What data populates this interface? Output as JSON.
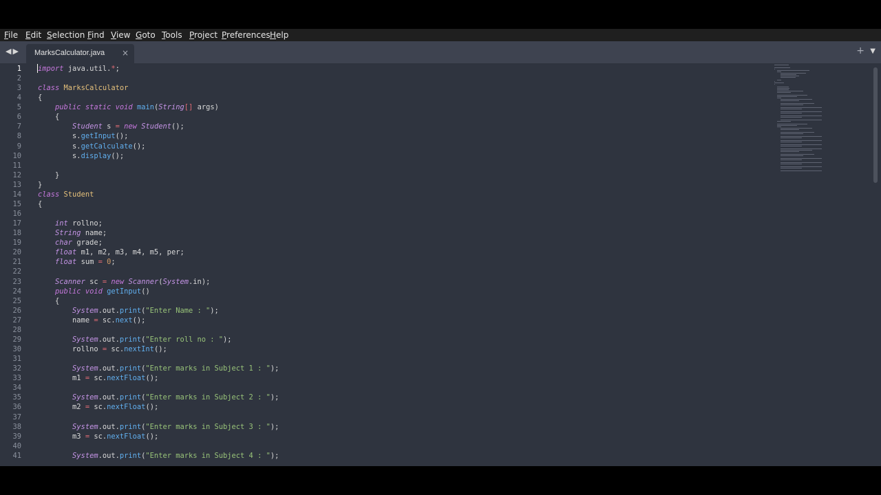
{
  "menu": [
    {
      "label": "File"
    },
    {
      "label": "Edit"
    },
    {
      "label": "Selection"
    },
    {
      "label": "Find"
    },
    {
      "label": "View"
    },
    {
      "label": "Goto"
    },
    {
      "label": "Tools"
    },
    {
      "label": "Project"
    },
    {
      "label": "Preferences"
    },
    {
      "label": "Help"
    }
  ],
  "tabs": {
    "nav_back": "◀",
    "nav_forward": "▶",
    "active_label": "MarksCalculator.java",
    "close_icon": "×",
    "new_tab_icon": "+",
    "menu_icon": "▼"
  },
  "editor": {
    "line_numbers": [
      "1",
      "2",
      "3",
      "4",
      "5",
      "6",
      "7",
      "8",
      "9",
      "10",
      "11",
      "12",
      "13",
      "14",
      "15",
      "16",
      "17",
      "18",
      "19",
      "20",
      "21",
      "22",
      "23",
      "24",
      "25",
      "26",
      "27",
      "28",
      "29",
      "30",
      "31",
      "32",
      "33",
      "34",
      "35",
      "36",
      "37",
      "38",
      "39",
      "40",
      "41"
    ],
    "lines": [
      "import java.util.*;",
      "",
      "class MarksCalculator",
      "{",
      "    public static void main(String[] args)",
      "    {",
      "        Student s = new Student();",
      "        s.getInput();",
      "        s.getCalculate();",
      "        s.display();",
      "",
      "    }",
      "}",
      "class Student",
      "{",
      "",
      "    int rollno;",
      "    String name;",
      "    char grade;",
      "    float m1, m2, m3, m4, m5, per;",
      "    float sum = 0;",
      "",
      "    Scanner sc = new Scanner(System.in);",
      "    public void getInput()",
      "    {",
      "        System.out.print(\"Enter Name : \");",
      "        name = sc.next();",
      "",
      "        System.out.print(\"Enter roll no : \");",
      "        rollno = sc.nextInt();",
      "",
      "        System.out.print(\"Enter marks in Subject 1 : \");",
      "        m1 = sc.nextFloat();",
      "",
      "        System.out.print(\"Enter marks in Subject 2 : \");",
      "        m2 = sc.nextFloat();",
      "",
      "        System.out.print(\"Enter marks in Subject 3 : \");",
      "        m3 = sc.nextFloat();",
      "",
      "        System.out.print(\"Enter marks in Subject 4 : \");"
    ],
    "active_line": 1
  },
  "colors": {
    "background": "#2f343f",
    "tabbar": "#3e4350",
    "menubar": "#1f1f1f",
    "keyword": "#c678dd",
    "class_name": "#e5c07b",
    "function": "#61afef",
    "string": "#98c379",
    "number": "#d19a66"
  }
}
